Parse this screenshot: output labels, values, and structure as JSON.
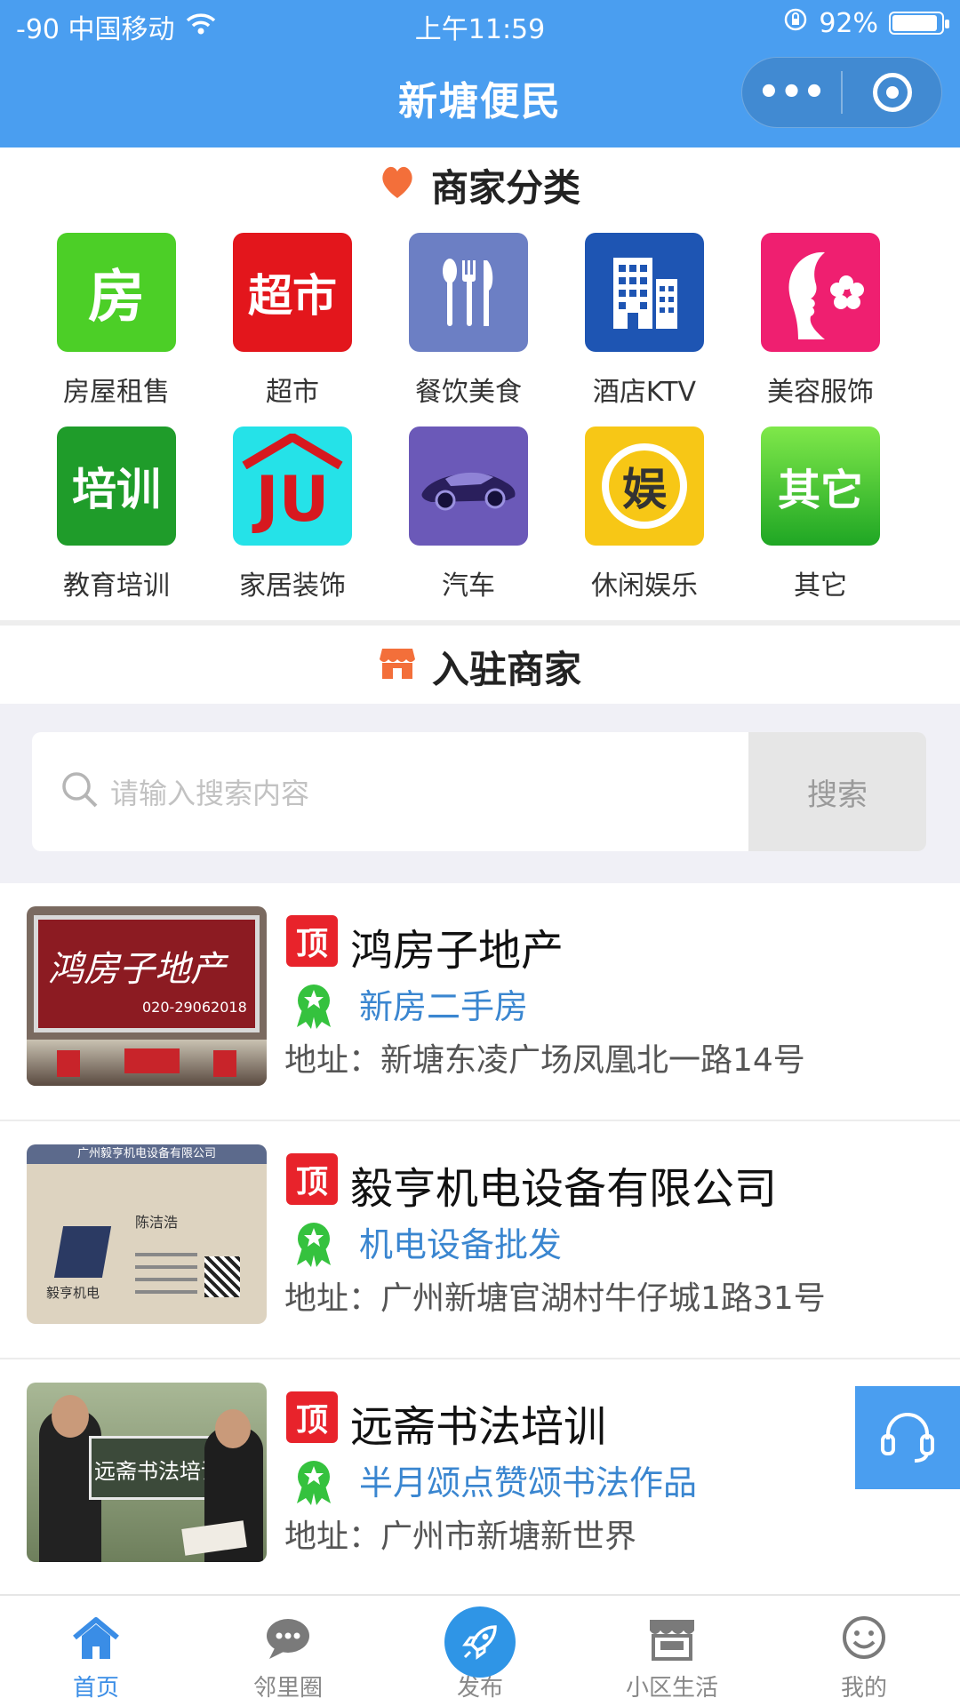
{
  "status_bar": {
    "signal": "-90 中国移动",
    "time": "上午11:59",
    "battery": "92%",
    "battery_level": 0.92
  },
  "header": {
    "title": "新塘便民"
  },
  "categories_section": {
    "title": "商家分类",
    "items": [
      {
        "label": "房屋租售",
        "icon": "house-icon",
        "glyph": "房",
        "color": "#4ccf27"
      },
      {
        "label": "超市",
        "icon": "supermarket-icon",
        "glyph": "超市",
        "color": "#e3161c"
      },
      {
        "label": "餐饮美食",
        "icon": "fork-knife-icon",
        "glyph": "",
        "color": "#6c7fc4"
      },
      {
        "label": "酒店KTV",
        "icon": "building-icon",
        "glyph": "",
        "color": "#1e55b3"
      },
      {
        "label": "美容服饰",
        "icon": "beauty-icon",
        "glyph": "",
        "color": "#ef1f70"
      },
      {
        "label": "教育培训",
        "icon": "training-icon",
        "glyph": "培训",
        "color": "#1f9c2a"
      },
      {
        "label": "家居装饰",
        "icon": "home-decor-icon",
        "glyph": "JU",
        "color": "#25e2e8"
      },
      {
        "label": "汽车",
        "icon": "car-icon",
        "glyph": "",
        "color": "#6b59b8"
      },
      {
        "label": "休闲娱乐",
        "icon": "entertainment-icon",
        "glyph": "娱",
        "color": "#f7c716"
      },
      {
        "label": "其它",
        "icon": "other-icon",
        "glyph": "其它",
        "color": "#38c028"
      }
    ]
  },
  "merchants_section": {
    "title": "入驻商家"
  },
  "search": {
    "placeholder": "请输入搜索内容",
    "button": "搜索"
  },
  "merchants": [
    {
      "top": "顶",
      "name": "鸿房子地产",
      "tag": "新房二手房",
      "address": "地址：新塘东凌广场凤凰北一路14号"
    },
    {
      "top": "顶",
      "name": "毅亨机电设备有限公司",
      "tag": "机电设备批发",
      "address": "地址：广州新塘官湖村牛仔城1路31号"
    },
    {
      "top": "顶",
      "name": "远斋书法培训",
      "tag": "半月颂点赞颂书法作品",
      "address": "地址：广州市新塘新世界"
    }
  ],
  "thumbs": {
    "m0_sign": "鸿房子地产",
    "m0_phone": "020-29062018",
    "m1_company": "广州毅亨机电设备有限公司",
    "m1_person": "陈洁浩",
    "m1_brand": "毅亨机电",
    "m2_sign": "远斋书法培训"
  },
  "tabs": [
    {
      "label": "首页",
      "icon": "home-icon",
      "active": true
    },
    {
      "label": "邻里圈",
      "icon": "chat-icon",
      "active": false
    },
    {
      "label": "发布",
      "icon": "rocket-icon",
      "active": false
    },
    {
      "label": "小区生活",
      "icon": "shop-icon",
      "active": false
    },
    {
      "label": "我的",
      "icon": "smile-icon",
      "active": false
    }
  ],
  "colors": {
    "primary": "#4a9ef0",
    "top_badge": "#e8232b",
    "tag_text": "#3a86d0"
  }
}
